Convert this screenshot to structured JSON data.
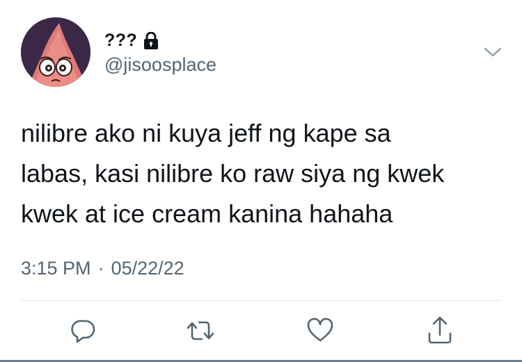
{
  "tweet": {
    "display_name": "???",
    "handle": "@jisoosplace",
    "text": "nilibre ako ni kuya jeff ng kape sa\nlabas, kasi nilibre ko raw siya ng kwek\nkwek at ice cream kanina hahaha",
    "time": "3:15 PM",
    "separator": "·",
    "date": "05/22/22"
  },
  "icons": {
    "lock": "lock-icon",
    "more": "chevron-down-icon",
    "reply": "reply-icon",
    "retweet": "retweet-icon",
    "like": "heart-icon",
    "share": "share-icon"
  },
  "colors": {
    "text": "#0f1419",
    "secondary": "#536471",
    "icon": "#536471"
  }
}
